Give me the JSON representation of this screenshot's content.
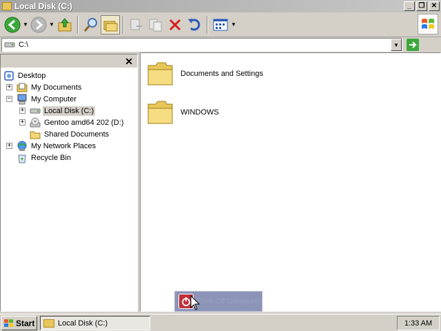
{
  "window": {
    "title": "Local Disk (C:)",
    "controls": {
      "minimize": "_",
      "restore": "❐",
      "close": "✕"
    }
  },
  "toolbar": {
    "buttons": [
      "back",
      "forward",
      "up",
      "search",
      "folders",
      "move-to",
      "copy-to",
      "delete",
      "undo",
      "views"
    ]
  },
  "address": {
    "value": "C:\\"
  },
  "folders_pane": {
    "close_glyph": "✕",
    "tree": [
      {
        "label": "Desktop",
        "icon": "desktop-icon",
        "expander": "",
        "selected": false
      },
      {
        "label": "My Documents",
        "icon": "my-documents-icon",
        "expander": "+",
        "selected": false
      },
      {
        "label": "My Computer",
        "icon": "my-computer-icon",
        "expander": "−",
        "selected": false
      },
      {
        "label": "Local Disk (C:)",
        "icon": "hard-drive-icon",
        "expander": "+",
        "selected": true
      },
      {
        "label": "Gentoo amd64 202 (D:)",
        "icon": "cd-drive-icon",
        "expander": "+",
        "selected": false
      },
      {
        "label": "Shared Documents",
        "icon": "folder-icon",
        "expander": "",
        "selected": false
      },
      {
        "label": "My Network Places",
        "icon": "network-places-icon",
        "expander": "+",
        "selected": false
      },
      {
        "label": "Recycle Bin",
        "icon": "recycle-bin-icon",
        "expander": "",
        "selected": false
      }
    ]
  },
  "content": {
    "items": [
      {
        "label": "Documents and Settings",
        "icon": "folder-icon"
      },
      {
        "label": "WINDOWS",
        "icon": "folder-icon"
      }
    ]
  },
  "popup": {
    "label": "Turn Off Computer"
  },
  "taskbar": {
    "start_label": "Start",
    "task_label": "Local Disk (C:)",
    "clock": "1:33 AM"
  }
}
